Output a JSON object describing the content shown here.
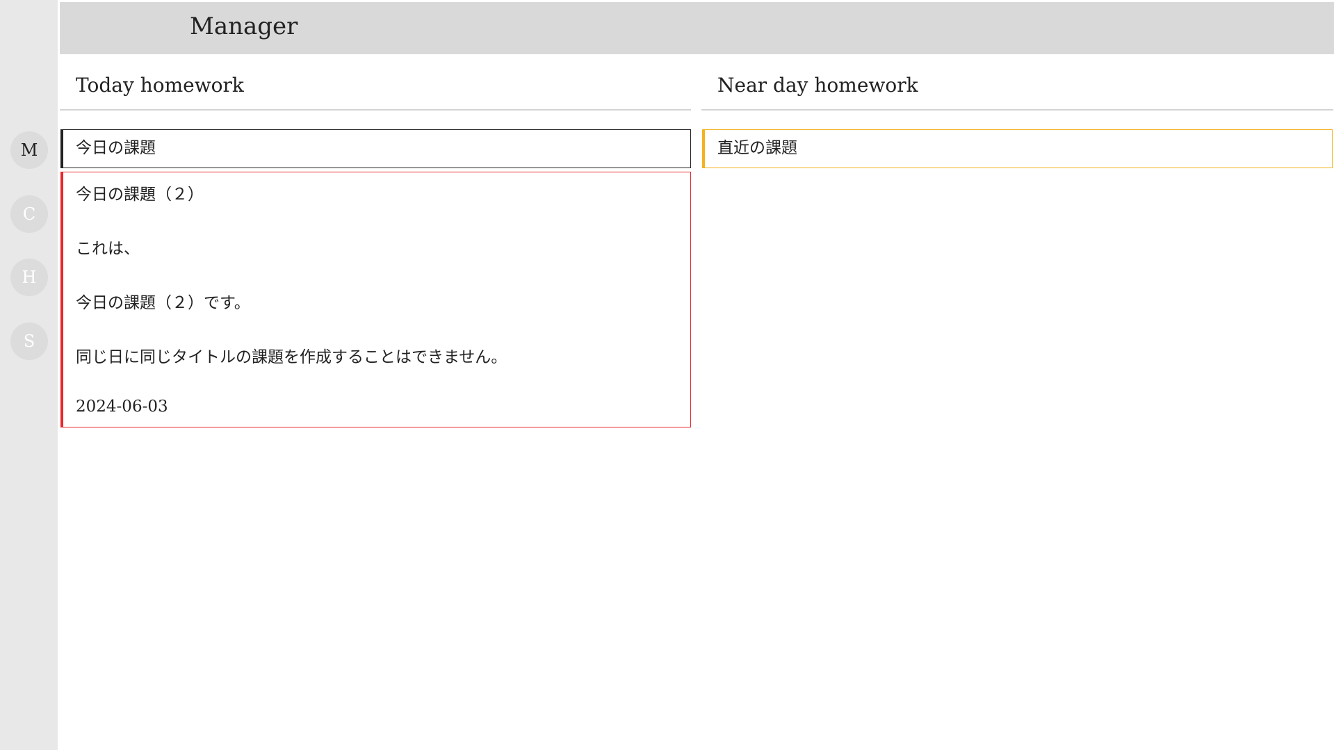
{
  "header": {
    "title": "Manager"
  },
  "rail": {
    "items": [
      {
        "label": "M",
        "active": true
      },
      {
        "label": "C",
        "active": false
      },
      {
        "label": "H",
        "active": false
      },
      {
        "label": "S",
        "active": false
      }
    ]
  },
  "today": {
    "heading": "Today homework",
    "cards": [
      {
        "title": "今日の課題",
        "accent": "#222222"
      },
      {
        "title": "今日の課題（２）",
        "body": [
          "これは、",
          "今日の課題（２）です。",
          "同じ日に同じタイトルの課題を作成することはできません。"
        ],
        "date": "2024-06-03",
        "accent": "#e8262b"
      }
    ]
  },
  "near": {
    "heading": "Near day homework",
    "cards": [
      {
        "title": "直近の課題",
        "accent": "#f2b320"
      }
    ]
  }
}
